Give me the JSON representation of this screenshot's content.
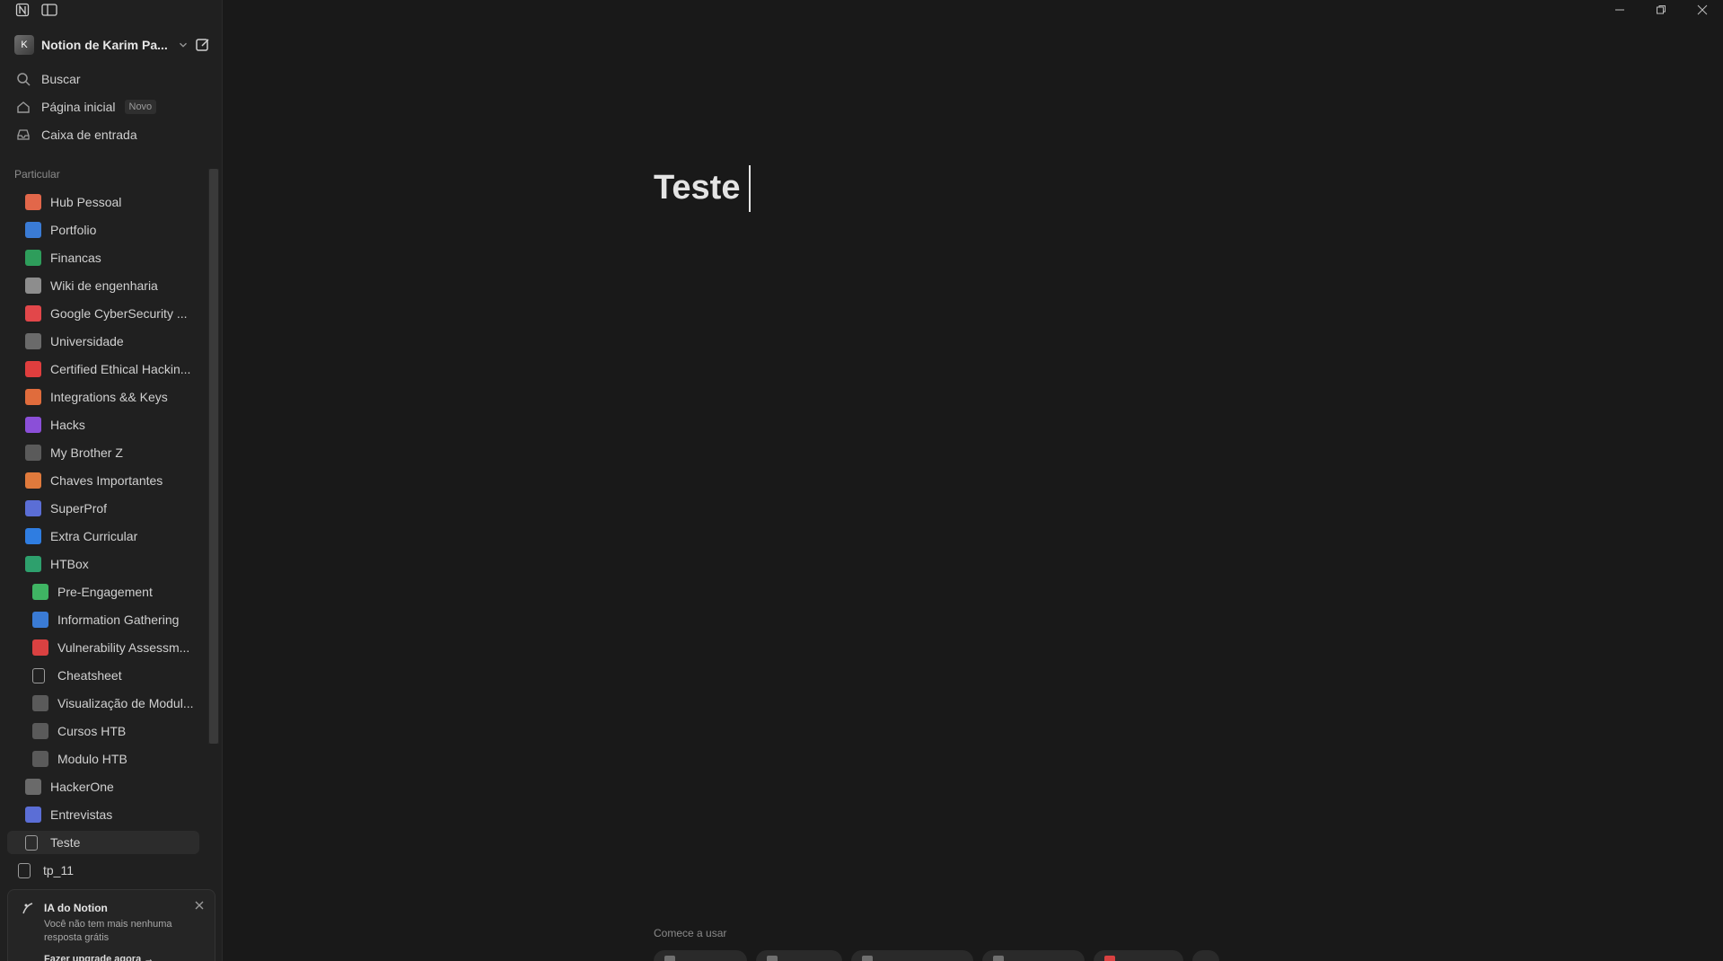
{
  "workspace": {
    "name": "Notion de Karim Pa..."
  },
  "nav": {
    "search": "Buscar",
    "home": "Página inicial",
    "home_badge": "Novo",
    "inbox": "Caixa de entrada"
  },
  "section_label": "Particular",
  "tree": [
    {
      "label": "Hub Pessoal",
      "color": "#e2674a",
      "icon": "book-icon"
    },
    {
      "label": "Portfolio",
      "color": "#3a7bd5",
      "icon": "blocks-icon"
    },
    {
      "label": "Financas",
      "color": "#2e9d5b",
      "icon": "cash-icon"
    },
    {
      "label": "Wiki de engenharia",
      "color": "#8d8d8d",
      "icon": "notebook-icon"
    },
    {
      "label": "Google CyberSecurity ...",
      "color": "#e2474a",
      "icon": "google-icon"
    },
    {
      "label": "Universidade",
      "color": "#6a6a6a",
      "icon": "grad-cap-icon"
    },
    {
      "label": "Certified Ethical Hackin...",
      "color": "#e03e3e",
      "icon": "terminal-icon"
    },
    {
      "label": "Integrations && Keys",
      "color": "#e06c3c",
      "icon": "key-icon"
    },
    {
      "label": "Hacks",
      "color": "#8b4fd8",
      "icon": "terminal-icon"
    },
    {
      "label": "My Brother Z",
      "color": "#5a5a5a",
      "icon": "dots-icon"
    },
    {
      "label": "Chaves Importantes",
      "color": "#e07a3c",
      "icon": "key-icon"
    },
    {
      "label": "SuperProf",
      "color": "#5b6ed6",
      "icon": "avatar-icon"
    },
    {
      "label": "Extra Curricular",
      "color": "#2f7de1",
      "icon": "laptop-icon"
    },
    {
      "label": "HTBox",
      "color": "#2ea06d",
      "icon": "cube-icon"
    },
    {
      "label": "Pre-Engagement",
      "color": "#3fb463",
      "icon": "handshake-icon",
      "child": true
    },
    {
      "label": "Information Gathering",
      "color": "#3a7bd5",
      "icon": "search-icon",
      "child": true
    },
    {
      "label": "Vulnerability Assessm...",
      "color": "#d94141",
      "icon": "bug-icon",
      "child": true
    },
    {
      "label": "Cheatsheet",
      "color": "#9b9b9b",
      "icon": "page-icon",
      "child": true
    },
    {
      "label": "Visualização de Modul...",
      "color": "#5a5a5a",
      "icon": "table-icon",
      "child": true
    },
    {
      "label": "Cursos HTB",
      "color": "#5a5a5a",
      "icon": "table-icon",
      "child": true
    },
    {
      "label": "Modulo HTB",
      "color": "#5a5a5a",
      "icon": "table-icon",
      "child": true
    },
    {
      "label": "HackerOne",
      "color": "#6a6a6a",
      "icon": "person-icon"
    },
    {
      "label": "Entrevistas",
      "color": "#5b6ed6",
      "icon": "avatar-icon"
    },
    {
      "label": "Teste",
      "color": "#5a5a5a",
      "icon": "page-icon",
      "selected": true
    },
    {
      "label": "tp_11",
      "color": "#5a5a5a",
      "icon": "page-icon",
      "top_level": true
    }
  ],
  "ai_card": {
    "title": "IA do Notion",
    "desc": "Você não tem mais nenhuma resposta grátis",
    "link": "Fazer upgrade agora →"
  },
  "page": {
    "title": "Teste",
    "start_label": "Comece a usar"
  }
}
